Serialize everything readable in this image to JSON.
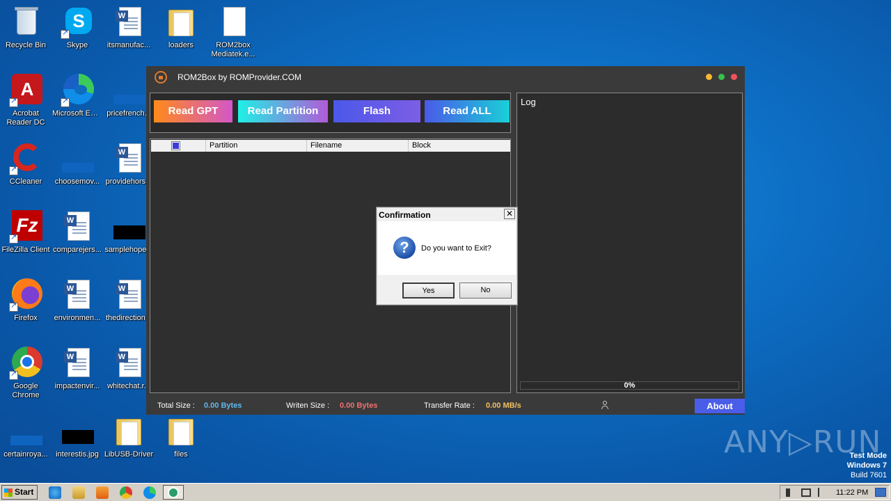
{
  "desktop": {
    "icons": [
      {
        "label": "Recycle Bin"
      },
      {
        "label": "Skype"
      },
      {
        "label": "itsmanufac..."
      },
      {
        "label": "loaders"
      },
      {
        "label": "ROM2box Mediatek.e..."
      },
      {
        "label": "Acrobat Reader DC"
      },
      {
        "label": "Microsoft Edge"
      },
      {
        "label": "pricefrench..."
      },
      {
        "label": "CCleaner"
      },
      {
        "label": "choosemov..."
      },
      {
        "label": "providehors..."
      },
      {
        "label": "FileZilla Client"
      },
      {
        "label": "comparejers..."
      },
      {
        "label": "samplehope..."
      },
      {
        "label": "Firefox"
      },
      {
        "label": "environmen..."
      },
      {
        "label": "thedirection..."
      },
      {
        "label": "Google Chrome"
      },
      {
        "label": "impactenvir..."
      },
      {
        "label": "whitechat.r..."
      },
      {
        "label": "certainroya..."
      },
      {
        "label": "interestis.jpg"
      },
      {
        "label": "LibUSB-Driver"
      },
      {
        "label": "files"
      }
    ]
  },
  "app": {
    "title": "ROM2Box by ROMProvider.COM",
    "buttons": {
      "read_gpt": "Read GPT",
      "read_partition": "Read Partition",
      "flash": "Flash",
      "read_all": "Read ALL"
    },
    "table": {
      "columns": [
        "Partition",
        "Filename",
        "Block"
      ]
    },
    "log": {
      "label": "Log",
      "progress": "0%"
    },
    "status": {
      "total_size_label": "Total Size :",
      "total_size_value": "0.00 Bytes",
      "written_size_label": "Writen Size :",
      "written_size_value": "0.00 Bytes",
      "transfer_rate_label": "Transfer Rate :",
      "transfer_rate_value": "0.00 MB/s",
      "about_label": "About"
    }
  },
  "dialog": {
    "title": "Confirmation",
    "close_glyph": "✕",
    "message": "Do you want to Exit?",
    "yes_label": "Yes",
    "no_label": "No"
  },
  "watermark": {
    "brand": "ANY▷RUN",
    "test_mode": "Test Mode",
    "os": "Windows 7",
    "build": "Build 7601"
  },
  "taskbar": {
    "start_label": "Start",
    "clock": "11:22 PM"
  },
  "colors": {
    "total_size": "#5fb8f0",
    "written_size": "#f07070",
    "transfer_rate": "#f0c060",
    "about_bg": "#4a5de8"
  }
}
